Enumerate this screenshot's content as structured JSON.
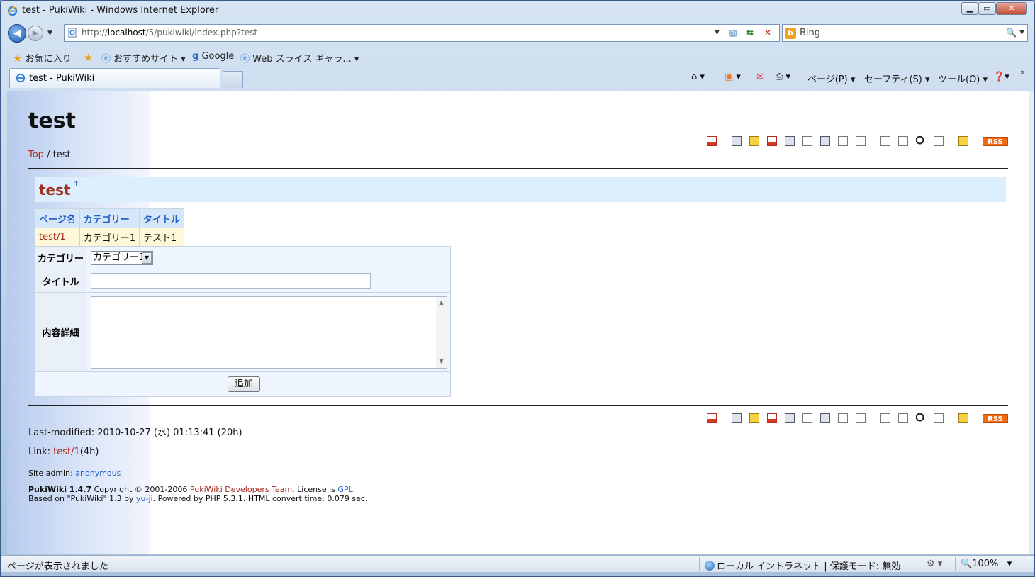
{
  "window": {
    "title": "test - PukiWiki - Windows Internet Explorer"
  },
  "navbar": {
    "url_prefix": "http://",
    "url_host": "localhost",
    "url_path": "/5/pukiwiki/index.php?test",
    "search_placeholder": "Bing"
  },
  "favorites": {
    "label": "お気に入り",
    "items": [
      "おすすめサイト",
      "Google",
      "Web スライス ギャラ..."
    ]
  },
  "tabs": [
    {
      "label": "test - PukiWiki"
    }
  ],
  "commands": {
    "page": "ページ(P)",
    "safety": "セーフティ(S)",
    "tools": "ツール(O)"
  },
  "page": {
    "title": "test",
    "breadcrumb": {
      "top": "Top",
      "sep": " / ",
      "current": "test"
    },
    "heading": "test",
    "heading_anchor": "†",
    "rss_label": "RSS",
    "list": {
      "headers": [
        "ページ名",
        "カテゴリー",
        "タイトル"
      ],
      "rows": [
        [
          "test/1",
          "カテゴリー1",
          "テスト1"
        ]
      ]
    },
    "form": {
      "category_label": "カテゴリー",
      "category_value": "カテゴリー1",
      "title_label": "タイトル",
      "title_value": "",
      "detail_label": "内容詳細",
      "detail_value": "",
      "submit": "追加"
    },
    "footer": {
      "last_modified": "Last-modified: 2010-10-27 (水) 01:13:41 (20h)",
      "link_prefix": "Link: ",
      "link_text": "test/1",
      "link_suffix": "(4h)",
      "site_admin_prefix": "Site admin: ",
      "site_admin": "anonymous",
      "credit_bold": "PukiWiki 1.4.7",
      "credit_mid": " Copyright © 2001-2006 ",
      "credit_team": "PukiWiki Developers Team",
      "credit_license": ". License is ",
      "credit_gpl": "GPL",
      "credit_end": ".",
      "based_prefix": "Based on \"PukiWiki\" 1.3 by ",
      "based_author": "yu-ji",
      "based_suffix": ". Powered by PHP 5.3.1. HTML convert time: 0.079 sec."
    }
  },
  "status": {
    "message": "ページが表示されました",
    "zone": "ローカル イントラネット | 保護モード: 無効",
    "zoom": "100%"
  }
}
